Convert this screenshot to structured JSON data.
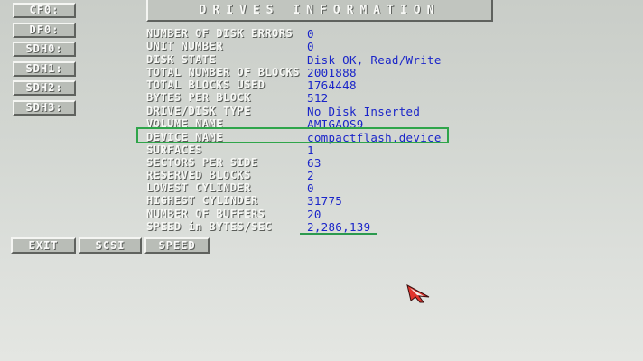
{
  "title": "DRIVES INFORMATION",
  "drives": [
    "CF0:",
    "DF0:",
    "SDH0:",
    "SDH1:",
    "SDH2:",
    "SDH3:"
  ],
  "info": {
    "rows": [
      {
        "label": "NUMBER OF DISK ERRORS",
        "value": "0"
      },
      {
        "label": "UNIT NUMBER",
        "value": "0"
      },
      {
        "label": "DISK STATE",
        "value": "Disk OK, Read/Write"
      },
      {
        "label": "TOTAL NUMBER OF BLOCKS",
        "value": "2001888"
      },
      {
        "label": "TOTAL BLOCKS USED",
        "value": "1764448"
      },
      {
        "label": "BYTES PER BLOCK",
        "value": "512"
      },
      {
        "label": "DRIVE/DISK TYPE",
        "value": "No Disk Inserted"
      },
      {
        "label": "VOLUME NAME",
        "value": "AMIGAOS9"
      },
      {
        "label": "DEVICE NAME",
        "value": "compactflash.device"
      },
      {
        "label": "SURFACES",
        "value": "1"
      },
      {
        "label": "SECTORS PER SIDE",
        "value": "63"
      },
      {
        "label": "RESERVED BLOCKS",
        "value": "2"
      },
      {
        "label": "LOWEST CYLINDER",
        "value": "0"
      },
      {
        "label": "HIGHEST CYLINDER",
        "value": "31775"
      },
      {
        "label": "NUMBER OF BUFFERS",
        "value": "20"
      },
      {
        "label": "SPEED in BYTES/SEC",
        "value": "2,286,139"
      }
    ]
  },
  "buttons": {
    "exit": "EXIT",
    "scsi": "SCSI",
    "speed": "SPEED"
  },
  "colors": {
    "label": "#f7f8f5",
    "value": "#1a25c9",
    "highlight": "#2fa54a",
    "background": "#d3d7d2"
  },
  "icons": {
    "pointer": "mouse-pointer-icon"
  }
}
